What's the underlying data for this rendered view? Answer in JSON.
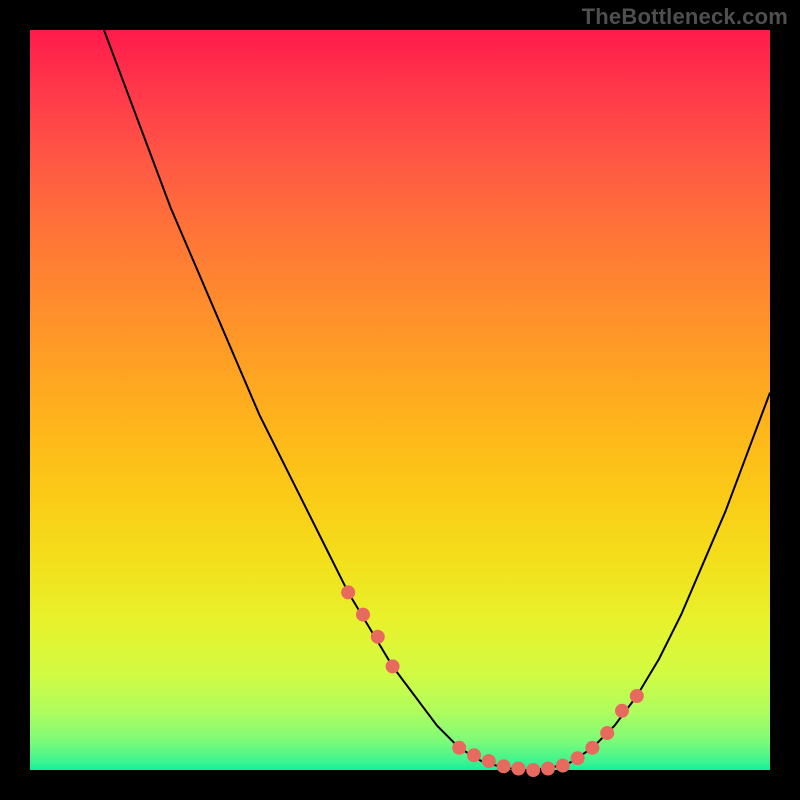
{
  "watermark": "TheBottleneck.com",
  "colors": {
    "curve": "#000000",
    "markers": "#e86a5e",
    "gradient_top": "#ff1b4b",
    "gradient_bottom": "#15ef9a",
    "background": "#000000"
  },
  "chart_data": {
    "type": "line",
    "title": "",
    "xlabel": "",
    "ylabel": "",
    "xlim": [
      0,
      100
    ],
    "ylim": [
      0,
      100
    ],
    "series": [
      {
        "name": "bottleneck_curve",
        "x": [
          10,
          13,
          16,
          19,
          22,
          25,
          28,
          31,
          34,
          37,
          40,
          43,
          46,
          49,
          52,
          55,
          58,
          61,
          64,
          67,
          70,
          73,
          76,
          79,
          82,
          85,
          88,
          91,
          94,
          97,
          100
        ],
        "y": [
          100,
          92,
          84,
          76,
          69,
          62,
          55,
          48,
          42,
          36,
          30,
          24,
          19,
          14,
          10,
          6,
          3,
          1.2,
          0.3,
          0,
          0.2,
          1.0,
          3,
          6,
          10,
          15,
          21,
          28,
          35,
          43,
          51
        ]
      }
    ],
    "markers": {
      "name": "highlighted_points",
      "x": [
        43,
        45,
        47,
        49,
        58,
        60,
        62,
        64,
        66,
        68,
        70,
        72,
        74,
        76,
        78,
        80,
        82
      ],
      "y": [
        24,
        21,
        18,
        14,
        3,
        2,
        1.2,
        0.5,
        0.2,
        0,
        0.2,
        0.6,
        1.6,
        3,
        5,
        8,
        10
      ]
    },
    "grid": false,
    "legend": false
  }
}
